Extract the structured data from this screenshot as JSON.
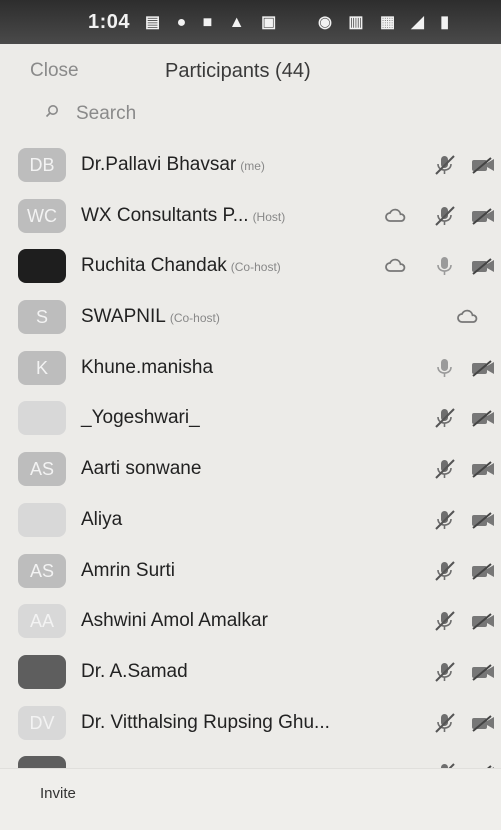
{
  "status_bar": {
    "time": "1:04",
    "left_icons": "▤ ● ■ ▲ ▣",
    "right_icons": "◉ ▥ ▦ ◢ ▮"
  },
  "header": {
    "close_label": "Close",
    "title": "Participants (44)"
  },
  "search": {
    "placeholder": "Search"
  },
  "participants": [
    {
      "name": "Dr.Pallavi Bhavsar",
      "tag": "(me)",
      "initials": "DB",
      "avatar": "initials",
      "icons": [
        "mic-muted",
        "camera-off"
      ]
    },
    {
      "name": "WX Consultants P...",
      "tag": "(Host)",
      "initials": "WC",
      "avatar": "initials",
      "icons": [
        "cloud",
        "mic-muted",
        "camera-off"
      ]
    },
    {
      "name": "Ruchita Chandak",
      "tag": "(Co-host)",
      "initials": "",
      "avatar": "logo",
      "icons": [
        "cloud",
        "mic-on",
        "camera-off"
      ]
    },
    {
      "name": "SWAPNIL",
      "tag": "(Co-host)",
      "initials": "S",
      "avatar": "initials",
      "icons": [
        "cloud"
      ]
    },
    {
      "name": "Khune.manisha",
      "tag": "",
      "initials": "K",
      "avatar": "initials",
      "icons": [
        "mic-on",
        "camera-off"
      ]
    },
    {
      "name": "_Yogeshwari_",
      "tag": "",
      "initials": "",
      "avatar": "initials-light",
      "icons": [
        "mic-muted",
        "camera-off"
      ]
    },
    {
      "name": "Aarti sonwane",
      "tag": "",
      "initials": "AS",
      "avatar": "initials",
      "icons": [
        "mic-muted",
        "camera-off"
      ]
    },
    {
      "name": "Aliya",
      "tag": "",
      "initials": "",
      "avatar": "initials-light",
      "icons": [
        "mic-muted",
        "camera-off"
      ]
    },
    {
      "name": "Amrin Surti",
      "tag": "",
      "initials": "AS",
      "avatar": "initials",
      "icons": [
        "mic-muted",
        "camera-off"
      ]
    },
    {
      "name": "Ashwini Amol  Amalkar",
      "tag": "",
      "initials": "AA",
      "avatar": "initials-light",
      "icons": [
        "mic-muted",
        "camera-off"
      ]
    },
    {
      "name": "Dr. A.Samad",
      "tag": "",
      "initials": "",
      "avatar": "photo",
      "icons": [
        "mic-muted",
        "camera-off"
      ]
    },
    {
      "name": "Dr. Vitthalsing Rupsing Ghu...",
      "tag": "",
      "initials": "DV",
      "avatar": "initials-light",
      "icons": [
        "mic-muted",
        "camera-off"
      ]
    },
    {
      "name": "",
      "tag": "",
      "initials": "",
      "avatar": "photo",
      "icons": [
        "mic-muted",
        "camera-off"
      ]
    }
  ],
  "footer": {
    "invite_label": "Invite"
  },
  "colors": {
    "background": "#ecebe8",
    "avatar": "#bdbdbd",
    "muted_text": "#8a8a8a"
  }
}
